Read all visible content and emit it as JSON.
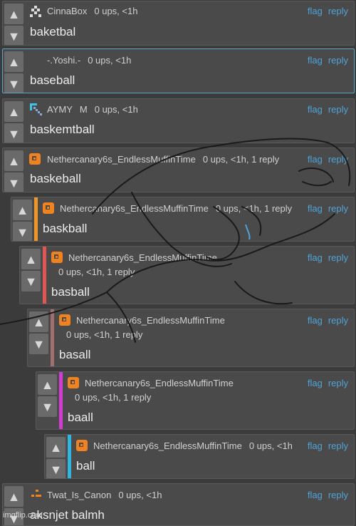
{
  "comments": [
    {
      "user": "CinnaBox",
      "meta": "0 ups, <1h",
      "body": "baketbal",
      "flag": "flag",
      "reply": "reply",
      "avatar": "pixel-cross-avatar"
    },
    {
      "user": "-.Yoshi.-",
      "meta": "0 ups, <1h",
      "body": "baseball",
      "flag": "flag",
      "reply": "reply",
      "avatar": "none"
    },
    {
      "user": "AYMY",
      "tag": "M",
      "meta": "0 ups, <1h",
      "body": "baskemtball",
      "flag": "flag",
      "reply": "reply",
      "avatar": "pixel-pickaxe-avatar"
    },
    {
      "user": "Nethercanary6s_EndlessMuffinTime",
      "meta": "0 ups, <1h, 1 reply",
      "body": "baskeball",
      "flag": "flag",
      "reply": "reply",
      "avatar": "orange-muffin-avatar"
    },
    {
      "user": "Nethercanary6s_EndlessMuffinTime",
      "meta": "0 ups, <1h, 1 reply",
      "body": "baskball",
      "flag": "flag",
      "reply": "reply",
      "avatar": "orange-muffin-avatar",
      "accent": "#f0952a"
    },
    {
      "user": "Nethercanary6s_EndlessMuffinTime",
      "meta": "0 ups, <1h, 1 reply",
      "body": "basball",
      "flag": "flag",
      "reply": "reply",
      "avatar": "orange-muffin-avatar",
      "accent": "#e25555"
    },
    {
      "user": "Nethercanary6s_EndlessMuffinTime",
      "meta": "0 ups, <1h, 1 reply",
      "body": "basall",
      "flag": "flag",
      "reply": "reply",
      "avatar": "orange-muffin-avatar",
      "accent": "#a07070"
    },
    {
      "user": "Nethercanary6s_EndlessMuffinTime",
      "meta": "0 ups, <1h, 1 reply",
      "body": "baall",
      "flag": "flag",
      "reply": "reply",
      "avatar": "orange-muffin-avatar",
      "accent": "#d23cd2"
    },
    {
      "user": "Nethercanary6s_EndlessMuffinTime",
      "meta": "0 ups, <1h",
      "body": "ball",
      "flag": "flag",
      "reply": "reply",
      "avatar": "orange-muffin-avatar",
      "accent": "#2fb6e0"
    },
    {
      "user": "Twat_Is_Canon",
      "meta": "0 ups, <1h",
      "body": "aksnjet balmh",
      "flag": "flag",
      "reply": "reply",
      "avatar": "orange-dots-avatar"
    }
  ],
  "vote_icons": {
    "up": "up-arrow-icon",
    "down": "down-arrow-icon"
  },
  "colors": {
    "link": "#4fa3d8",
    "muffin": "#f0831f"
  },
  "watermark": "imgflip.com"
}
